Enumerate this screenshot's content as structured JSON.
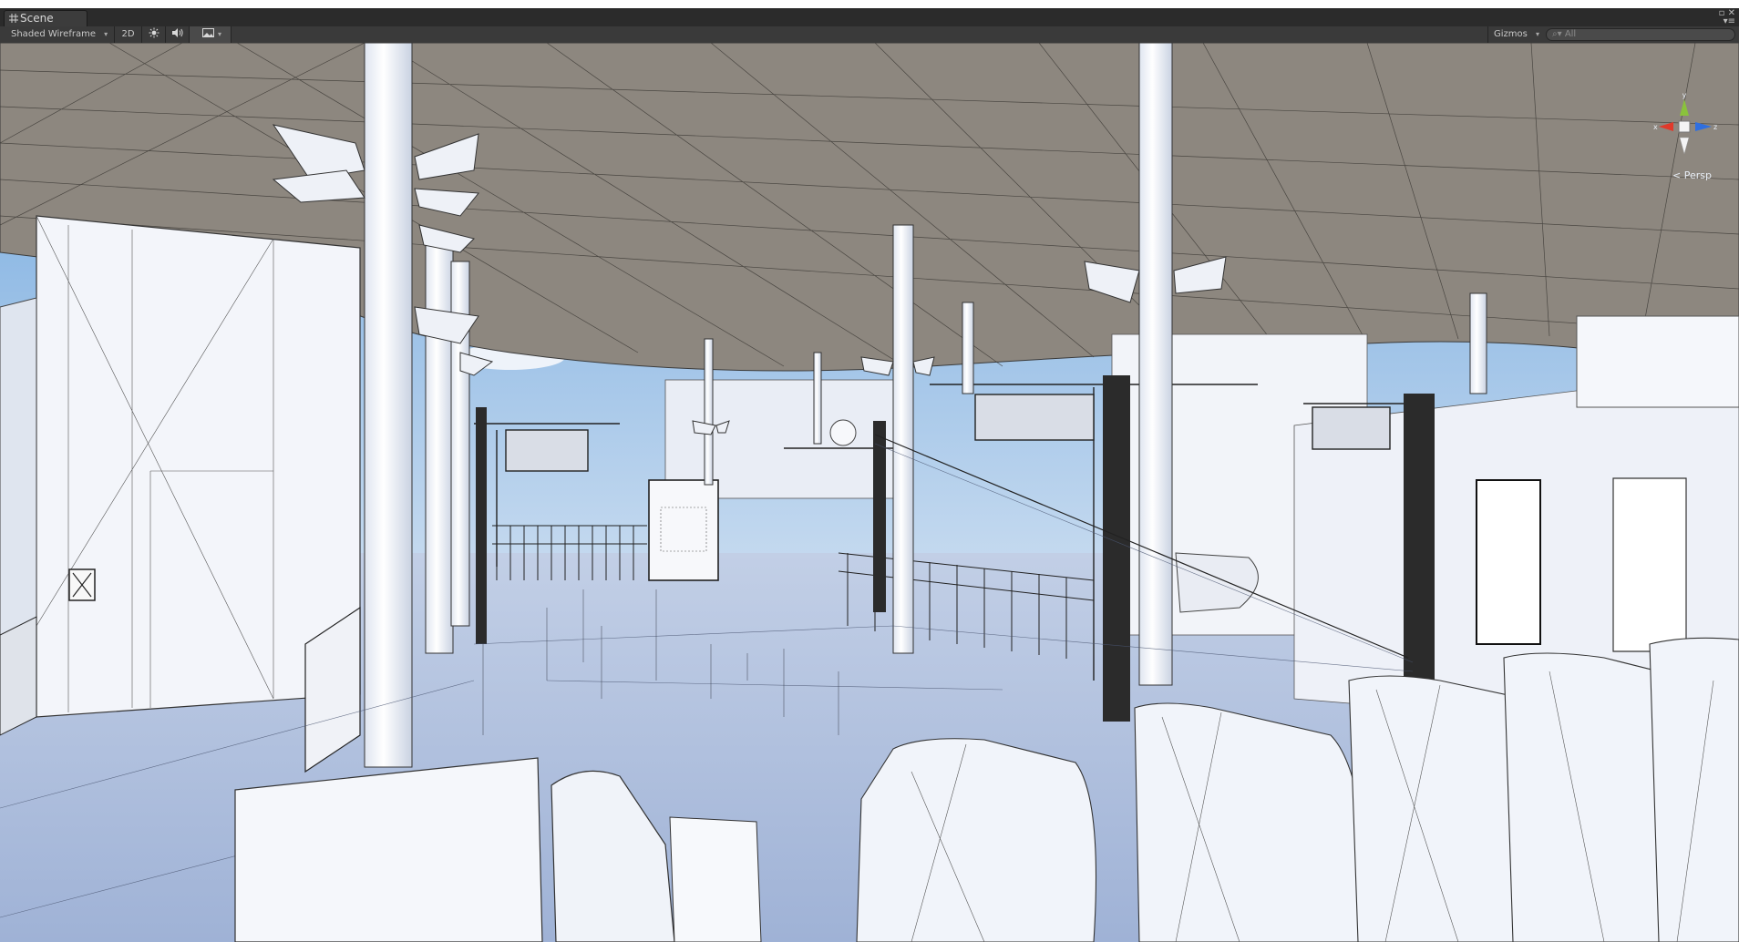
{
  "window": {
    "tab_title": "Scene",
    "tab_icon": "scene-grid-icon"
  },
  "toolbar": {
    "draw_mode": "Shaded Wireframe",
    "mode_2d": "2D",
    "lighting_icon": "sun-icon",
    "audio_icon": "speaker-icon",
    "effects_icon": "image-icon",
    "gizmos_label": "Gizmos",
    "search_placeholder": "All",
    "search_value": ""
  },
  "scene_gizmo": {
    "projection_label": "Persp",
    "axes": [
      "x",
      "y",
      "z"
    ],
    "colors": {
      "x": "#e0392b",
      "y": "#8ac23c",
      "z": "#2f6fe0"
    }
  },
  "viewport": {
    "content": "3D station concourse model with columns, fare gates and canopy roof",
    "colors": {
      "floor": "#b4c3df",
      "ceiling": "#8a847c",
      "wall": "#f3f5fa",
      "sky": "#87b6e6",
      "wire": "#222222"
    }
  }
}
